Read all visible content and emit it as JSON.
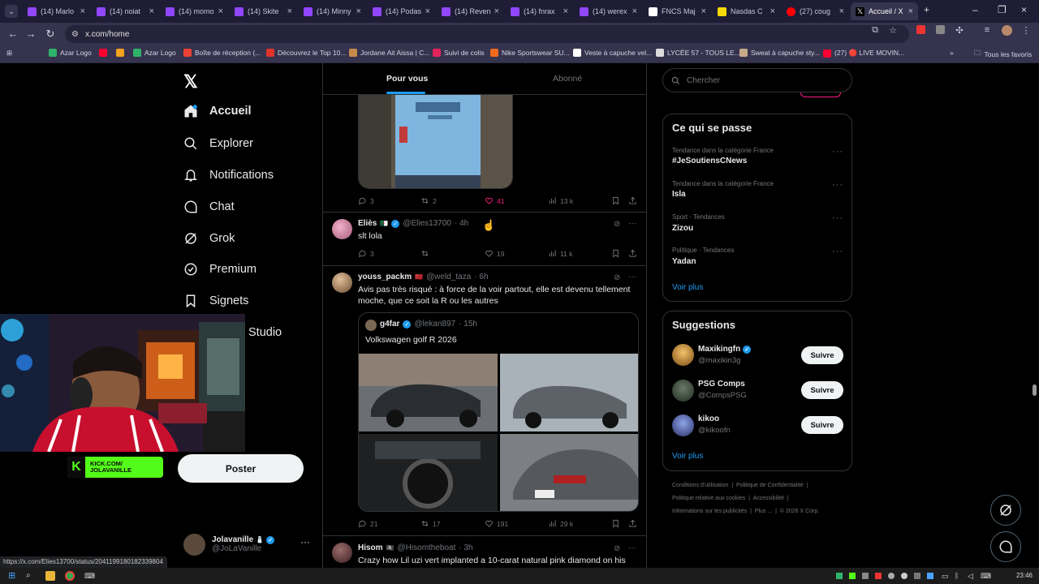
{
  "browser": {
    "tabs": [
      {
        "label": "(14) Marlo"
      },
      {
        "label": "(14) noiat"
      },
      {
        "label": "(14) momo"
      },
      {
        "label": "(14) Skite"
      },
      {
        "label": "(14) Minny"
      },
      {
        "label": "(14) Podas"
      },
      {
        "label": "(14) Reven"
      },
      {
        "label": "(14) fnrax"
      },
      {
        "label": "(14) werex"
      },
      {
        "label": "FNCS Maj"
      },
      {
        "label": "Nasdas C"
      },
      {
        "label": "(27) coug"
      },
      {
        "label": "Accueil / X"
      }
    ],
    "url": "x.com/home",
    "bookmarks": [
      {
        "label": "Azar Logo"
      },
      {
        "label": ""
      },
      {
        "label": ""
      },
      {
        "label": "Azar Logo"
      },
      {
        "label": "Boîte de réception (..."
      },
      {
        "label": "Découvrez le Top 10..."
      },
      {
        "label": "Jordane Ait Aissa | C..."
      },
      {
        "label": "Suivi de colis"
      },
      {
        "label": "Nike Sportswear SU..."
      },
      {
        "label": "Veste à capuche vel..."
      },
      {
        "label": "LYCÉE 57 - TOUS LE..."
      },
      {
        "label": "Sweat à capuche sty..."
      },
      {
        "label": "(27) 🔴 LIVE MOVIN..."
      }
    ],
    "all_bookmarks": "Tous les favoris",
    "status_url": "https://x.com/Elies13700/status/2041199180182339804"
  },
  "nav": {
    "items": [
      {
        "label": "Accueil"
      },
      {
        "label": "Explorer"
      },
      {
        "label": "Notifications"
      },
      {
        "label": "Chat"
      },
      {
        "label": "Grok"
      },
      {
        "label": "Premium"
      },
      {
        "label": "Signets"
      },
      {
        "label": "Studio"
      }
    ],
    "post_label": "Poster",
    "profile_name": "Jolavanille",
    "profile_emoji": "🧂",
    "profile_handle": "@JoLaVanille"
  },
  "kick": {
    "line1": "KICK.COM/",
    "line2": "JOLAVANILLE"
  },
  "feed": {
    "tabs": [
      {
        "label": "Pour vous"
      },
      {
        "label": "Abonné"
      }
    ],
    "tweets": [
      {
        "replies": "3",
        "reposts": "2",
        "likes": "41",
        "views": "13 k"
      },
      {
        "name": "Eliès",
        "flag": "🇩🇿",
        "handle": "@Elies13700",
        "time": "· 4h",
        "text": "slt lola",
        "replies": "3",
        "reposts": "",
        "likes": "19",
        "views": "11 k"
      },
      {
        "name": "youss_packm",
        "flag": "🇲🇦",
        "handle": "@weld_taza",
        "time": "· 6h",
        "text": "Avis pas très risqué : à force de la voir partout, elle est devenu tellement moche, que ce soit la R ou les autres",
        "quote": {
          "name": "g4far",
          "handle": "@lekan897",
          "time": "· 15h",
          "text": "Volkswagen golf R 2026"
        },
        "replies": "21",
        "reposts": "17",
        "likes": "191",
        "views": "29 k"
      },
      {
        "name": "Hisom",
        "flag": "🏴‍☠️",
        "handle": "@Hisomtheboat",
        "time": "· 3h",
        "text": "Crazy how Lil uzi vert implanted a 10-carat natural pink diamond on his"
      }
    ]
  },
  "sidebar": {
    "search_placeholder": "Chercher",
    "trends_title": "Ce qui se passe",
    "trends": [
      {
        "category": "Tendance dans la catégorie France",
        "name": "#JeSoutiensCNews"
      },
      {
        "category": "Tendance dans la catégorie France",
        "name": "Isla"
      },
      {
        "category": "Sport · Tendances",
        "name": "Zizou"
      },
      {
        "category": "Politique · Tendances",
        "name": "Yadan"
      }
    ],
    "trends_more": "Voir plus",
    "suggestions_title": "Suggestions",
    "suggestions": [
      {
        "name": "Maxikingfn",
        "handle": "@maxikin3g",
        "follow": "Suivre"
      },
      {
        "name": "PSG Comps",
        "handle": "@CompsPSG",
        "follow": "Suivre"
      },
      {
        "name": "kikoo",
        "handle": "@kikoofn",
        "follow": "Suivre"
      }
    ],
    "suggestions_more": "Voir plus",
    "footer": {
      "l1a": "Conditions d'utilisation",
      "l1b": "Politique de Confidentialité",
      "l2a": "Politique relative aux cookies",
      "l2b": "Accessibilité",
      "l3a": "Informations sur les publicités",
      "l3b": "Plus ...",
      "l3c": "© 2026 X Corp."
    }
  },
  "taskbar": {
    "time": "23:46"
  },
  "colors": {
    "accent": "#1d9bf0",
    "like": "#f91880",
    "kick": "#53fc18"
  }
}
